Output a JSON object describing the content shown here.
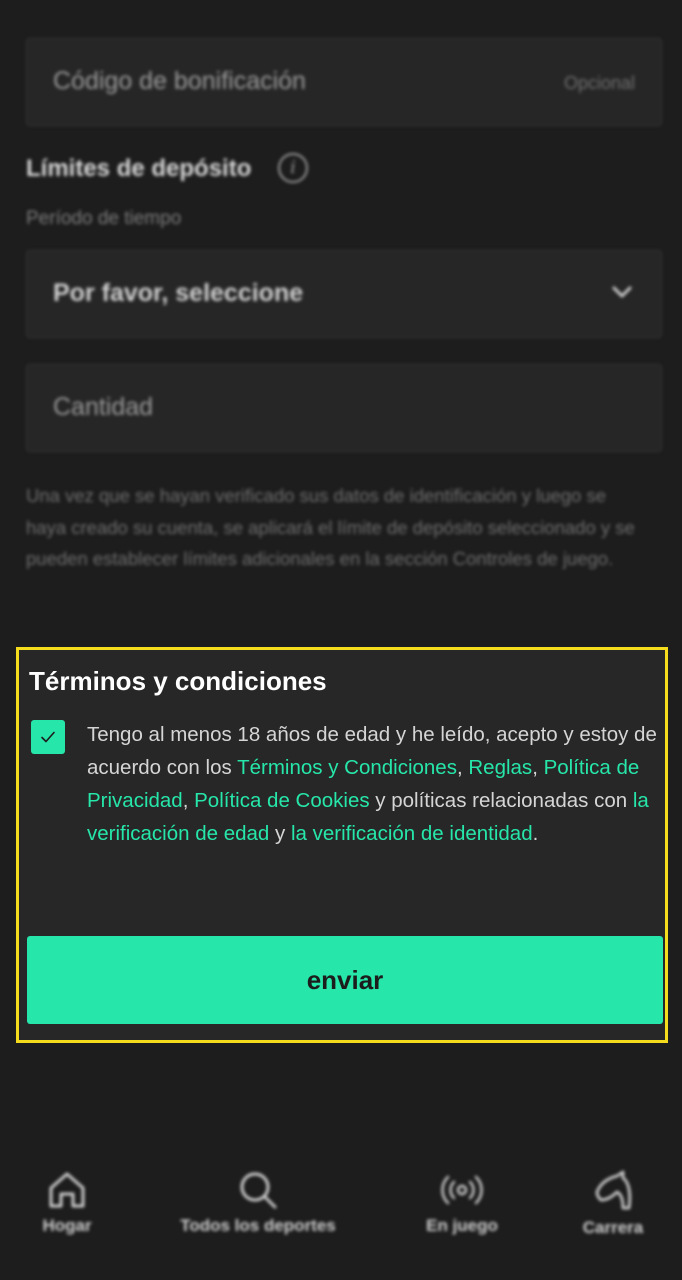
{
  "form": {
    "bonus_code": {
      "placeholder": "Código de bonificación",
      "optional_label": "Opcional"
    },
    "deposit_limits": {
      "title": "Límites de depósito",
      "period_label": "Período de tiempo",
      "period_select": "Por favor, seleccione",
      "amount_placeholder": "Cantidad",
      "note": "Una vez que se hayan verificado sus datos de identificación y luego se haya creado su cuenta, se aplicará el límite de depósito seleccionado y se pueden establecer límites adicionales en la sección Controles de juego."
    }
  },
  "terms": {
    "title": "Términos y condiciones",
    "checked": true,
    "text_1": "Tengo al menos 18 años de edad y he leído, acepto y estoy de acuerdo con los ",
    "link_terms": "Términos y Condiciones",
    "sep_1": ", ",
    "link_rules": "Reglas",
    "sep_2": ", ",
    "link_privacy": "Política de Privacidad",
    "sep_3": ", ",
    "link_cookies": "Política de Cookies",
    "text_2": " y políticas relacionadas con ",
    "link_age": "la verificación de edad",
    "text_3": " y ",
    "link_identity": "la verificación de identidad",
    "text_4": ".",
    "submit_label": "enviar"
  },
  "nav": {
    "items": [
      {
        "label": "Hogar",
        "icon": "home-icon"
      },
      {
        "label": "Todos los deportes",
        "icon": "search-icon"
      },
      {
        "label": "En juego",
        "icon": "live-broadcast-icon"
      },
      {
        "label": "Carrera",
        "icon": "horse-icon"
      }
    ]
  },
  "colors": {
    "accent": "#26e6a9",
    "highlight_border": "#f5dc1c",
    "background": "#1d1d1d"
  }
}
